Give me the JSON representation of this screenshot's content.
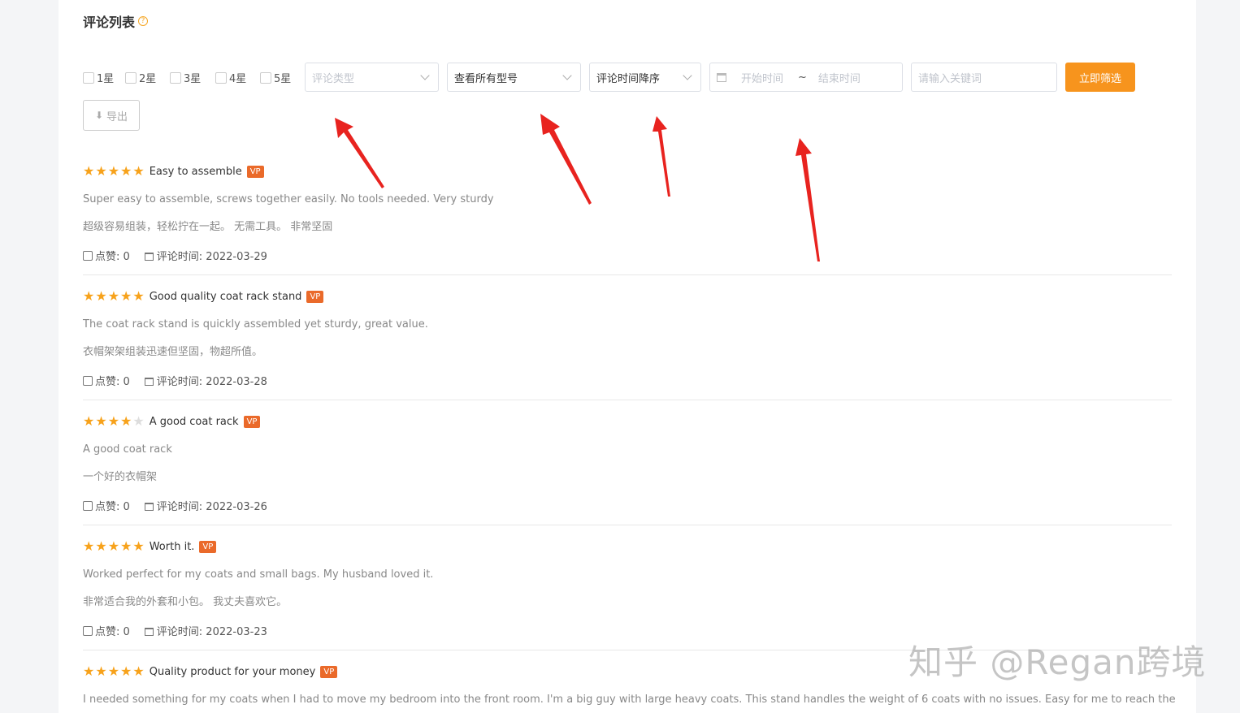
{
  "header": {
    "title": "评论列表",
    "help_glyph": "?"
  },
  "filters": {
    "star_options": [
      "1星",
      "2星",
      "3星",
      "4星",
      "5星"
    ],
    "review_type": {
      "placeholder": "评论类型"
    },
    "model": {
      "value": "查看所有型号"
    },
    "sort": {
      "value": "评论时间降序"
    },
    "date_range": {
      "start_placeholder": "开始时间",
      "separator": "~",
      "end_placeholder": "结束时间"
    },
    "keyword": {
      "placeholder": "请输入关键词"
    },
    "filter_button": "立即筛选",
    "export_button": "导出"
  },
  "reviews": [
    {
      "rating": 5,
      "title": "Easy to assemble",
      "badge": "VP",
      "body_en": "Super easy to assemble, screws together easily. No tools needed. Very sturdy",
      "body_cn": "超级容易组装，轻松拧在一起。 无需工具。 非常坚固",
      "likes": "点赞: 0",
      "date": "评论时间: 2022-03-29"
    },
    {
      "rating": 5,
      "title": "Good quality coat rack stand",
      "badge": "VP",
      "body_en": "The coat rack stand is quickly assembled yet sturdy, great value.",
      "body_cn": "衣帽架架组装迅速但坚固，物超所值。",
      "likes": "点赞: 0",
      "date": "评论时间: 2022-03-28"
    },
    {
      "rating": 4,
      "title": "A good coat rack",
      "badge": "VP",
      "body_en": "A good coat rack",
      "body_cn": "一个好的衣帽架",
      "likes": "点赞: 0",
      "date": "评论时间: 2022-03-26"
    },
    {
      "rating": 5,
      "title": "Worth it.",
      "badge": "VP",
      "body_en": "Worked perfect for my coats and small bags. My husband loved it.",
      "body_cn": "非常适合我的外套和小包。 我丈夫喜欢它。",
      "likes": "点赞: 0",
      "date": "评论时间: 2022-03-23"
    },
    {
      "rating": 5,
      "title": "Quality product for your money",
      "badge": "VP",
      "body_en": "I needed something for my coats when I had to move my bedroom into the front room. I'm a big guy with large heavy coats. This stand handles the weight of 6 coats with no issues. Easy for me to reach the",
      "body_cn": "",
      "likes": "",
      "date": ""
    }
  ],
  "watermark": "知乎 @Regan跨境",
  "colors": {
    "accent": "#f7941d",
    "star": "#f7a21b",
    "badge": "#ea6a2a",
    "arrow": "#e8231f"
  }
}
